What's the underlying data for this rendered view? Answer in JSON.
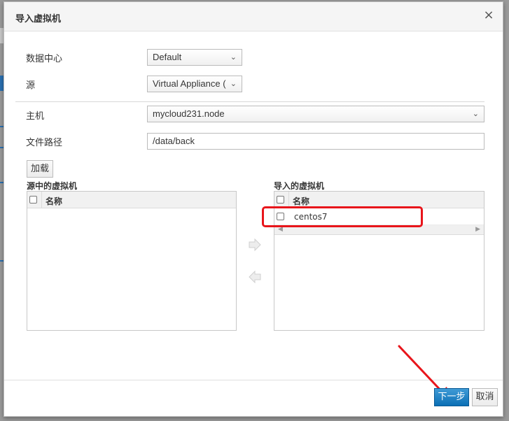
{
  "dialog": {
    "title": "导入虚拟机",
    "close_glyph": "×"
  },
  "form": {
    "datacenter_label": "数据中心",
    "datacenter_value": "Default",
    "source_label": "源",
    "source_value": "Virtual Appliance (",
    "host_label": "主机",
    "host_value": "mycloud231.node",
    "filepath_label": "文件路径",
    "filepath_value": "/data/back",
    "load_button": "加载"
  },
  "source_list": {
    "title": "源中的虚拟机",
    "column_name": "名称",
    "rows": []
  },
  "import_list": {
    "title": "导入的虚拟机",
    "column_name": "名称",
    "rows": [
      {
        "name": "centos7",
        "checked": false
      }
    ]
  },
  "footer": {
    "next_button": "下一步",
    "cancel_button": "取消"
  },
  "colors": {
    "primary": "#0b6fb5",
    "annotation_red": "#e8151b"
  }
}
